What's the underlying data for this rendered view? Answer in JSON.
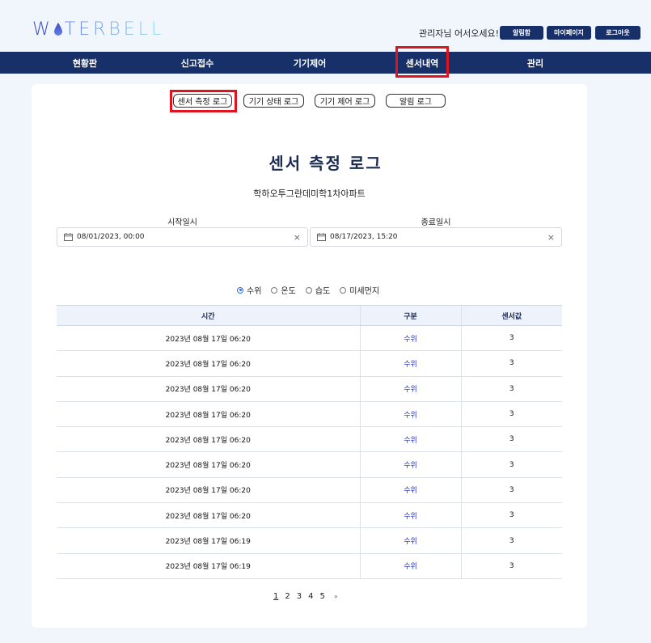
{
  "header": {
    "logo_prefix": "W",
    "logo_suffix": "TERBELL",
    "greeting": "관리자님 어서오세요!",
    "buttons": [
      "알림함",
      "마이페이지",
      "로그아웃"
    ]
  },
  "nav": {
    "items": [
      "현황판",
      "신고접수",
      "기기제어",
      "센서내역",
      "관리"
    ],
    "active": "센서내역"
  },
  "tabs": [
    "센서 측정 로그",
    "기기 상태 로그",
    "기기 제어 로그",
    "알림 로그"
  ],
  "page": {
    "title": "센서 측정 로그",
    "subtitle": "학하오투그란데미학1차아파트"
  },
  "filters": {
    "start_label": "시작일시",
    "start_value": "08/01/2023, 00:00",
    "end_label": "종료일시",
    "end_value": "08/17/2023, 15:20",
    "sensor_options": [
      "수위",
      "온도",
      "습도",
      "미세먼지"
    ],
    "selected_sensor": "수위"
  },
  "table": {
    "headers": [
      "시간",
      "구분",
      "센서값"
    ],
    "rows": [
      [
        "2023년 08월 17일 06:20",
        "수위",
        "3"
      ],
      [
        "2023년 08월 17일 06:20",
        "수위",
        "3"
      ],
      [
        "2023년 08월 17일 06:20",
        "수위",
        "3"
      ],
      [
        "2023년 08월 17일 06:20",
        "수위",
        "3"
      ],
      [
        "2023년 08월 17일 06:20",
        "수위",
        "3"
      ],
      [
        "2023년 08월 17일 06:20",
        "수위",
        "3"
      ],
      [
        "2023년 08월 17일 06:20",
        "수위",
        "3"
      ],
      [
        "2023년 08월 17일 06:20",
        "수위",
        "3"
      ],
      [
        "2023년 08월 17일 06:19",
        "수위",
        "3"
      ],
      [
        "2023년 08월 17일 06:19",
        "수위",
        "3"
      ]
    ]
  },
  "pagination": {
    "pages": [
      "1",
      "2",
      "3",
      "4",
      "5"
    ],
    "current": "1",
    "next": "»"
  },
  "colors": {
    "brand_navy": "#17306a",
    "highlight_red": "#e0141e",
    "category_blue": "#2230b8",
    "radio_blue": "#2e6be6"
  }
}
